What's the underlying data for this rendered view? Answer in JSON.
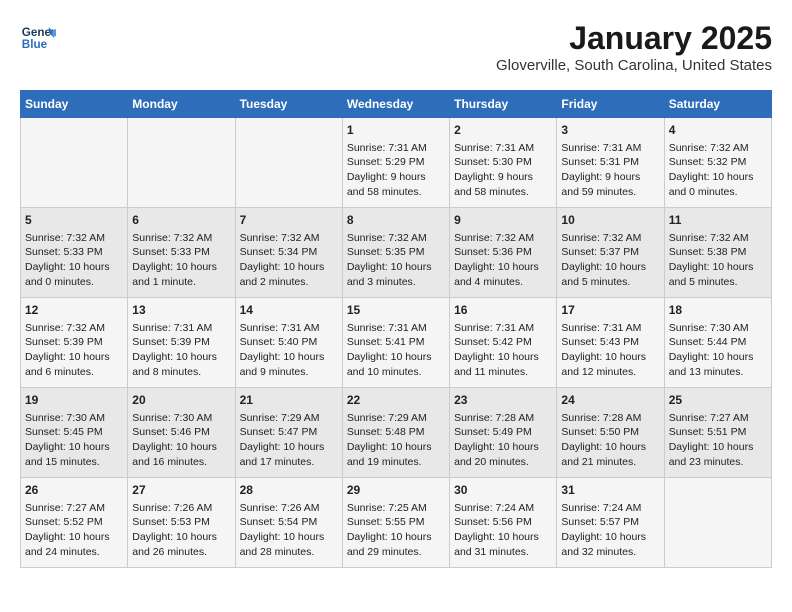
{
  "header": {
    "logo_line1": "General",
    "logo_line2": "Blue",
    "title": "January 2025",
    "subtitle": "Gloverville, South Carolina, United States"
  },
  "weekdays": [
    "Sunday",
    "Monday",
    "Tuesday",
    "Wednesday",
    "Thursday",
    "Friday",
    "Saturday"
  ],
  "weeks": [
    [
      {
        "day": "",
        "content": ""
      },
      {
        "day": "",
        "content": ""
      },
      {
        "day": "",
        "content": ""
      },
      {
        "day": "1",
        "content": "Sunrise: 7:31 AM\nSunset: 5:29 PM\nDaylight: 9 hours\nand 58 minutes."
      },
      {
        "day": "2",
        "content": "Sunrise: 7:31 AM\nSunset: 5:30 PM\nDaylight: 9 hours\nand 58 minutes."
      },
      {
        "day": "3",
        "content": "Sunrise: 7:31 AM\nSunset: 5:31 PM\nDaylight: 9 hours\nand 59 minutes."
      },
      {
        "day": "4",
        "content": "Sunrise: 7:32 AM\nSunset: 5:32 PM\nDaylight: 10 hours\nand 0 minutes."
      }
    ],
    [
      {
        "day": "5",
        "content": "Sunrise: 7:32 AM\nSunset: 5:33 PM\nDaylight: 10 hours\nand 0 minutes."
      },
      {
        "day": "6",
        "content": "Sunrise: 7:32 AM\nSunset: 5:33 PM\nDaylight: 10 hours\nand 1 minute."
      },
      {
        "day": "7",
        "content": "Sunrise: 7:32 AM\nSunset: 5:34 PM\nDaylight: 10 hours\nand 2 minutes."
      },
      {
        "day": "8",
        "content": "Sunrise: 7:32 AM\nSunset: 5:35 PM\nDaylight: 10 hours\nand 3 minutes."
      },
      {
        "day": "9",
        "content": "Sunrise: 7:32 AM\nSunset: 5:36 PM\nDaylight: 10 hours\nand 4 minutes."
      },
      {
        "day": "10",
        "content": "Sunrise: 7:32 AM\nSunset: 5:37 PM\nDaylight: 10 hours\nand 5 minutes."
      },
      {
        "day": "11",
        "content": "Sunrise: 7:32 AM\nSunset: 5:38 PM\nDaylight: 10 hours\nand 5 minutes."
      }
    ],
    [
      {
        "day": "12",
        "content": "Sunrise: 7:32 AM\nSunset: 5:39 PM\nDaylight: 10 hours\nand 6 minutes."
      },
      {
        "day": "13",
        "content": "Sunrise: 7:31 AM\nSunset: 5:39 PM\nDaylight: 10 hours\nand 8 minutes."
      },
      {
        "day": "14",
        "content": "Sunrise: 7:31 AM\nSunset: 5:40 PM\nDaylight: 10 hours\nand 9 minutes."
      },
      {
        "day": "15",
        "content": "Sunrise: 7:31 AM\nSunset: 5:41 PM\nDaylight: 10 hours\nand 10 minutes."
      },
      {
        "day": "16",
        "content": "Sunrise: 7:31 AM\nSunset: 5:42 PM\nDaylight: 10 hours\nand 11 minutes."
      },
      {
        "day": "17",
        "content": "Sunrise: 7:31 AM\nSunset: 5:43 PM\nDaylight: 10 hours\nand 12 minutes."
      },
      {
        "day": "18",
        "content": "Sunrise: 7:30 AM\nSunset: 5:44 PM\nDaylight: 10 hours\nand 13 minutes."
      }
    ],
    [
      {
        "day": "19",
        "content": "Sunrise: 7:30 AM\nSunset: 5:45 PM\nDaylight: 10 hours\nand 15 minutes."
      },
      {
        "day": "20",
        "content": "Sunrise: 7:30 AM\nSunset: 5:46 PM\nDaylight: 10 hours\nand 16 minutes."
      },
      {
        "day": "21",
        "content": "Sunrise: 7:29 AM\nSunset: 5:47 PM\nDaylight: 10 hours\nand 17 minutes."
      },
      {
        "day": "22",
        "content": "Sunrise: 7:29 AM\nSunset: 5:48 PM\nDaylight: 10 hours\nand 19 minutes."
      },
      {
        "day": "23",
        "content": "Sunrise: 7:28 AM\nSunset: 5:49 PM\nDaylight: 10 hours\nand 20 minutes."
      },
      {
        "day": "24",
        "content": "Sunrise: 7:28 AM\nSunset: 5:50 PM\nDaylight: 10 hours\nand 21 minutes."
      },
      {
        "day": "25",
        "content": "Sunrise: 7:27 AM\nSunset: 5:51 PM\nDaylight: 10 hours\nand 23 minutes."
      }
    ],
    [
      {
        "day": "26",
        "content": "Sunrise: 7:27 AM\nSunset: 5:52 PM\nDaylight: 10 hours\nand 24 minutes."
      },
      {
        "day": "27",
        "content": "Sunrise: 7:26 AM\nSunset: 5:53 PM\nDaylight: 10 hours\nand 26 minutes."
      },
      {
        "day": "28",
        "content": "Sunrise: 7:26 AM\nSunset: 5:54 PM\nDaylight: 10 hours\nand 28 minutes."
      },
      {
        "day": "29",
        "content": "Sunrise: 7:25 AM\nSunset: 5:55 PM\nDaylight: 10 hours\nand 29 minutes."
      },
      {
        "day": "30",
        "content": "Sunrise: 7:24 AM\nSunset: 5:56 PM\nDaylight: 10 hours\nand 31 minutes."
      },
      {
        "day": "31",
        "content": "Sunrise: 7:24 AM\nSunset: 5:57 PM\nDaylight: 10 hours\nand 32 minutes."
      },
      {
        "day": "",
        "content": ""
      }
    ]
  ]
}
